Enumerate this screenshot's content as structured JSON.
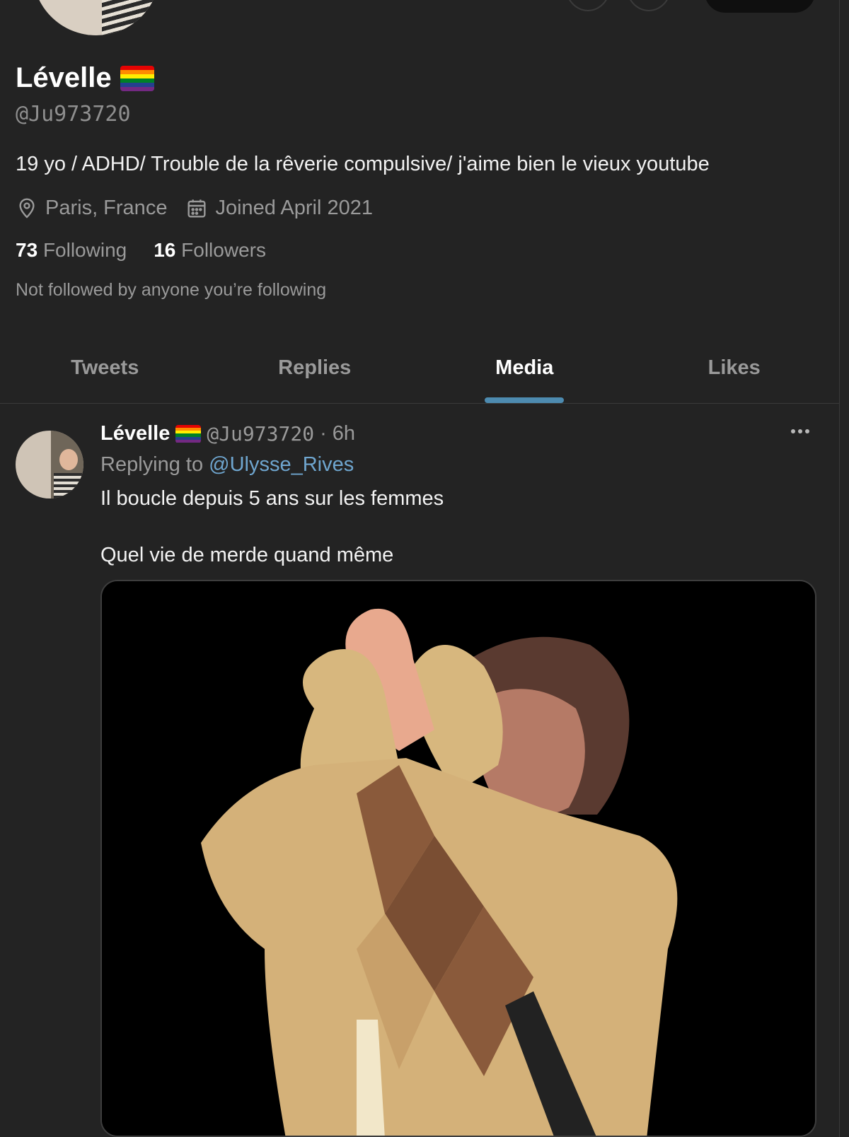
{
  "profile": {
    "display_name": "Lévelle",
    "handle": "@Ju973720",
    "bio": "19 yo / ADHD/ Trouble de la rêverie compulsive/ j'aime bien le vieux youtube",
    "location": "Paris, France",
    "joined": "Joined April 2021",
    "following_count": "73",
    "following_label": "Following",
    "followers_count": "16",
    "followers_label": "Followers",
    "not_followed_note": "Not followed by anyone you’re following"
  },
  "pride_flag_colors": [
    "#e40303",
    "#ff8c00",
    "#ffed00",
    "#008026",
    "#24408e",
    "#732982"
  ],
  "tabs": [
    {
      "label": "Tweets",
      "active": false
    },
    {
      "label": "Replies",
      "active": false
    },
    {
      "label": "Media",
      "active": true
    },
    {
      "label": "Likes",
      "active": false
    }
  ],
  "tweet": {
    "author_name": "Lévelle",
    "author_handle": "@Ju973720",
    "separator": "·",
    "time": "6h",
    "replying_prefix": "Replying to",
    "replying_to": "@Ulysse_Rives",
    "text_line_1": "Il boucle depuis 5 ans sur les femmes",
    "text_line_2": "Quel vie de merde quand même",
    "more_icon": "more-horizontal-icon"
  },
  "icons": {
    "location": "location-pin-icon",
    "calendar": "calendar-icon"
  },
  "colors": {
    "background": "#232323",
    "accent": "#4d8bb0",
    "mention": "#6fa6cf",
    "muted": "#9a9a9a"
  }
}
